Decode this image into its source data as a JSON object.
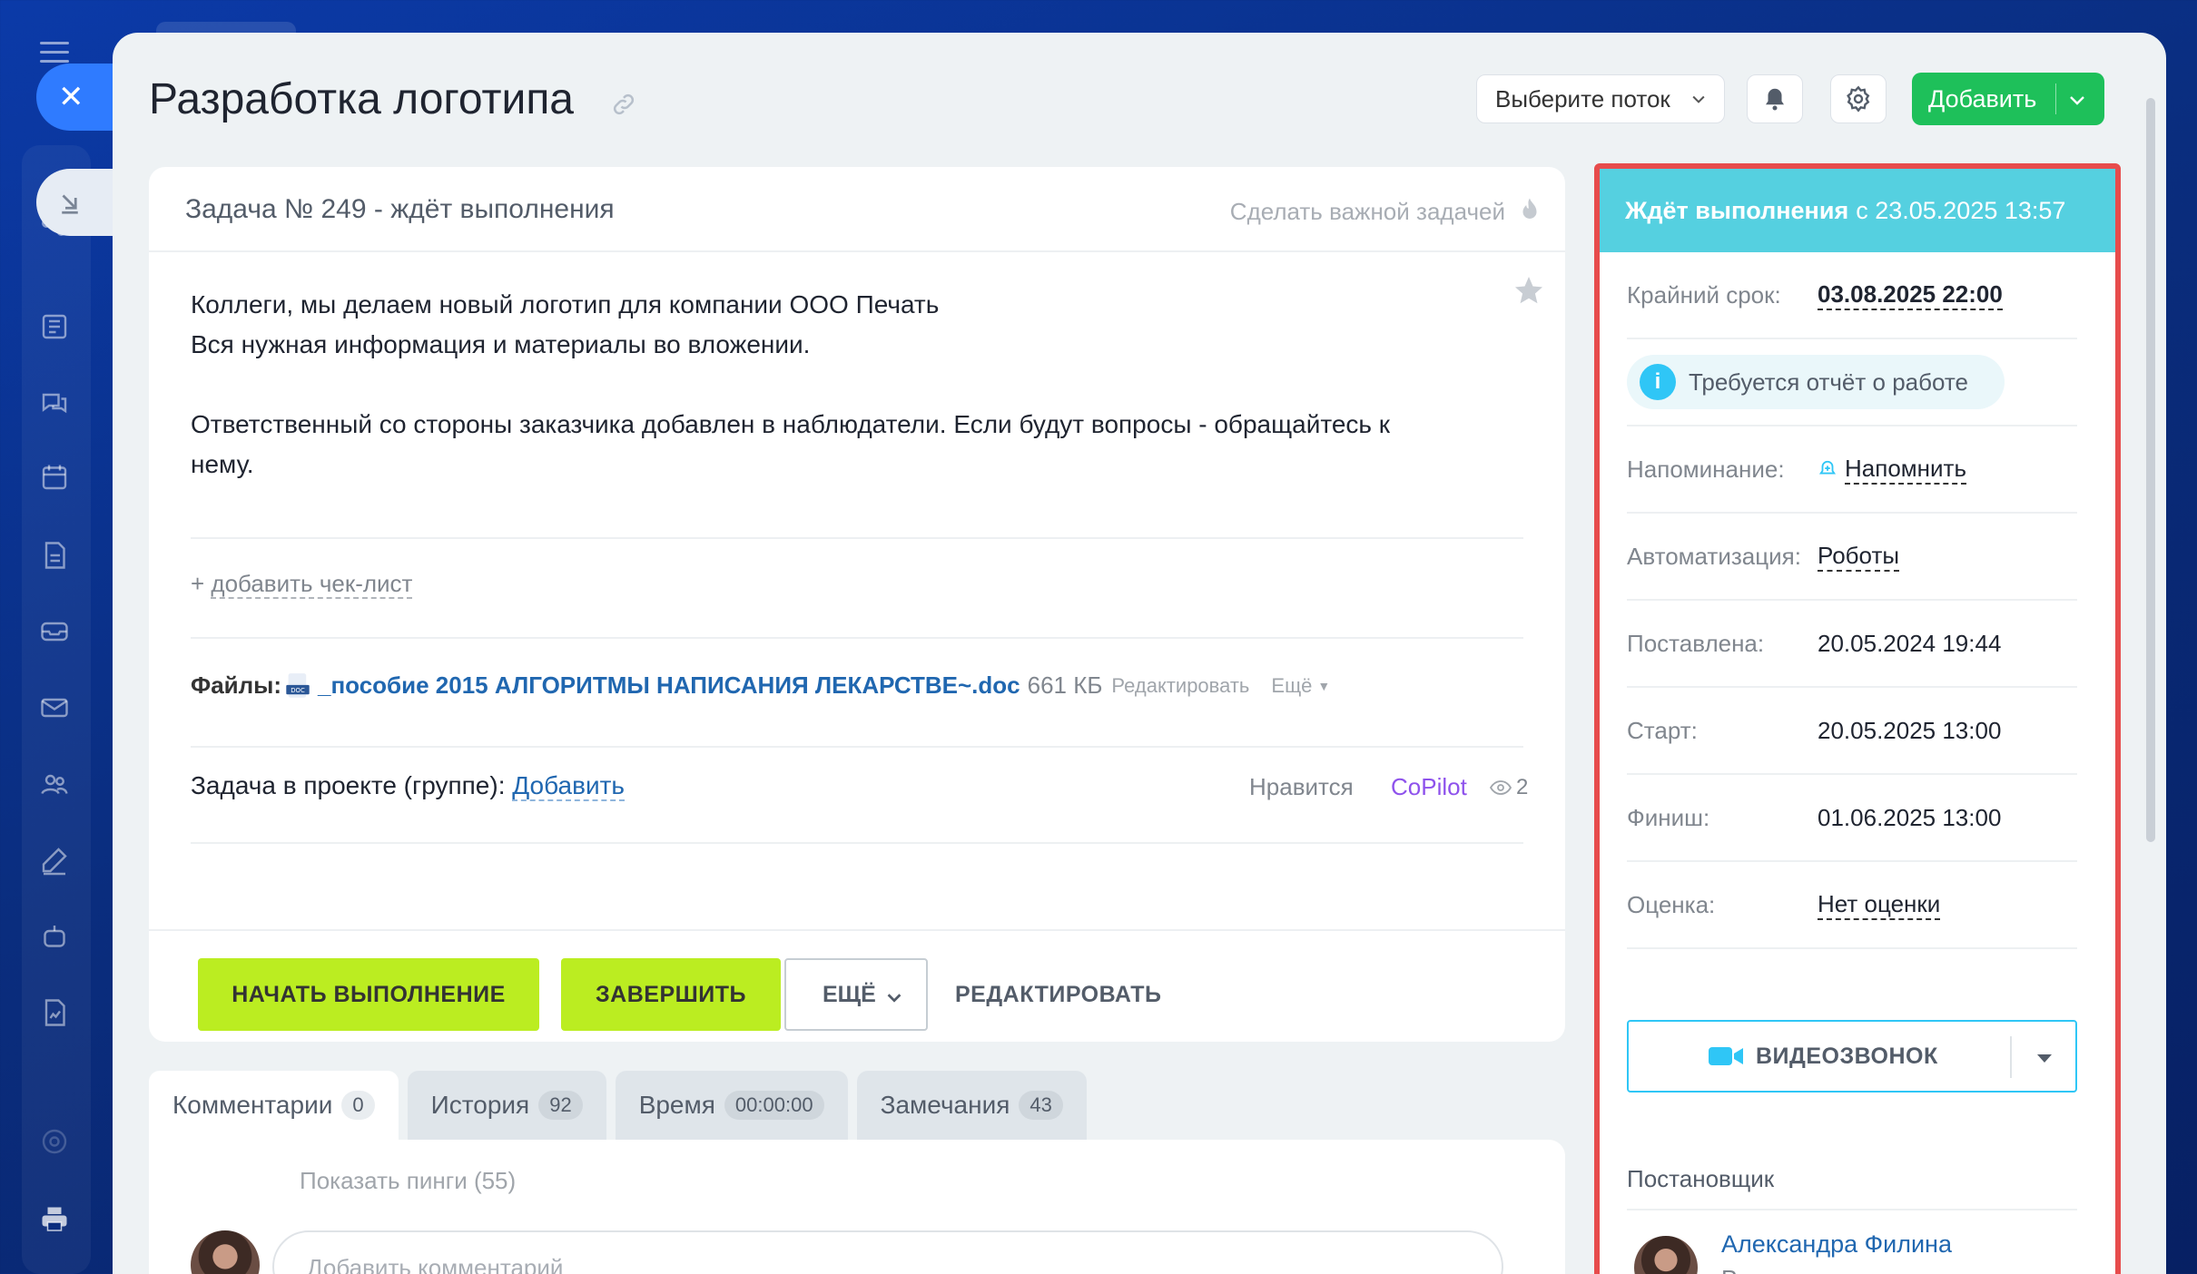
{
  "header": {
    "title": "Разработка логотипа",
    "flow_select": "Выберите поток",
    "add_label": "Добавить"
  },
  "task": {
    "heading": "Задача № 249 - ждёт выполнения",
    "make_important": "Сделать важной задачей",
    "description": [
      "Коллеги, мы делаем новый логотип для компании ООО Печать",
      "Вся нужная информация и материалы во вложении.",
      "",
      "Ответственный со стороны заказчика добавлен в наблюдатели. Если будут вопросы - обращайтесь к",
      "нему."
    ],
    "add_checklist_prefix": "+ ",
    "add_checklist": "добавить чек-лист",
    "files_label": "Файлы:",
    "file_name": "_пособие 2015 АЛГОРИТМЫ НАПИСАНИЯ ЛЕКАРСТВЕ~.doc",
    "file_size": "661 КБ",
    "file_edit": "Редактировать",
    "file_more": "Ещё",
    "project_label": "Задача в проекте (группе):",
    "project_add": "Добавить",
    "like": "Нравится",
    "copilot": "CoPilot",
    "views": "2"
  },
  "actions": {
    "start": "НАЧАТЬ ВЫПОЛНЕНИЕ",
    "finish": "ЗАВЕРШИТЬ",
    "more": "ЕЩЁ",
    "edit": "РЕДАКТИРОВАТЬ"
  },
  "tabs": [
    {
      "label": "Комментарии",
      "count": "0"
    },
    {
      "label": "История",
      "count": "92"
    },
    {
      "label": "Время",
      "count": "00:00:00"
    },
    {
      "label": "Замечания",
      "count": "43"
    }
  ],
  "comments": {
    "show_pings": "Показать пинги (55)",
    "placeholder": "Добавить комментарий"
  },
  "side": {
    "status_bold": "Ждёт выполнения",
    "status_rest": "с 23.05.2025 13:57",
    "deadline_label": "Крайний срок:",
    "deadline_value": "03.08.2025 22:00",
    "report_note": "Требуется отчёт о работе",
    "reminder_label": "Напоминание:",
    "reminder_value": "Напомнить",
    "automation_label": "Автоматизация:",
    "automation_value": "Роботы",
    "created_label": "Поставлена:",
    "created_value": "20.05.2024 19:44",
    "start_label": "Старт:",
    "start_value": "20.05.2025 13:00",
    "finish_label": "Финиш:",
    "finish_value": "01.06.2025 13:00",
    "rating_label": "Оценка:",
    "rating_value": "Нет оценки",
    "video_call": "ВИДЕОЗВОНОК",
    "creator_label": "Постановщик",
    "creator_name": "Александра Филина",
    "creator_position": "Руководитель отдела маркетинга"
  },
  "colors": {
    "accent_green": "#1ec05a",
    "action_lime": "#bbed21",
    "status_cyan": "#55d0e0",
    "highlight_red": "#e74c4c",
    "link_blue": "#2067b0"
  }
}
